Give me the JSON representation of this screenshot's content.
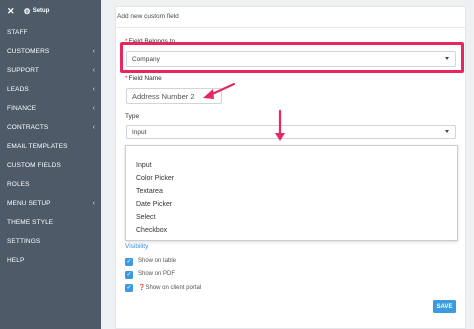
{
  "sidebar": {
    "close_glyph": "✕",
    "setup_label": "Setup",
    "items": [
      {
        "label": "STAFF",
        "has_submenu": false
      },
      {
        "label": "CUSTOMERS",
        "has_submenu": true
      },
      {
        "label": "SUPPORT",
        "has_submenu": true
      },
      {
        "label": "LEADS",
        "has_submenu": true
      },
      {
        "label": "FINANCE",
        "has_submenu": true
      },
      {
        "label": "CONTRACTS",
        "has_submenu": true
      },
      {
        "label": "EMAIL TEMPLATES",
        "has_submenu": false
      },
      {
        "label": "CUSTOM FIELDS",
        "has_submenu": false
      },
      {
        "label": "ROLES",
        "has_submenu": false
      },
      {
        "label": "MENU SETUP",
        "has_submenu": true
      },
      {
        "label": "THEME STYLE",
        "has_submenu": false
      },
      {
        "label": "SETTINGS",
        "has_submenu": false
      },
      {
        "label": "HELP",
        "has_submenu": false
      }
    ]
  },
  "form": {
    "title": "Add new custom field",
    "field_belongs_to": {
      "label": "Field Belongs to",
      "required_mark": "*",
      "value": "Company"
    },
    "field_name": {
      "label": "Field Name",
      "required_mark": "*",
      "value": "Address Number 2"
    },
    "type": {
      "label": "Type",
      "value": "Input",
      "options": [
        "Input",
        "Color Picker",
        "Textarea",
        "Date Picker",
        "Select",
        "Checkbox"
      ]
    },
    "visibility": {
      "title": "Visibility",
      "options": [
        {
          "label": "Show on table",
          "checked": true
        },
        {
          "label": "Show on PDF",
          "checked": true
        },
        {
          "label": "Show on client portal",
          "checked": true,
          "has_icon": true
        }
      ]
    },
    "save_label": "SAVE"
  },
  "colors": {
    "sidebar_bg": "#4d5a67",
    "highlight": "#e8275f",
    "accent": "#3b9be0"
  }
}
